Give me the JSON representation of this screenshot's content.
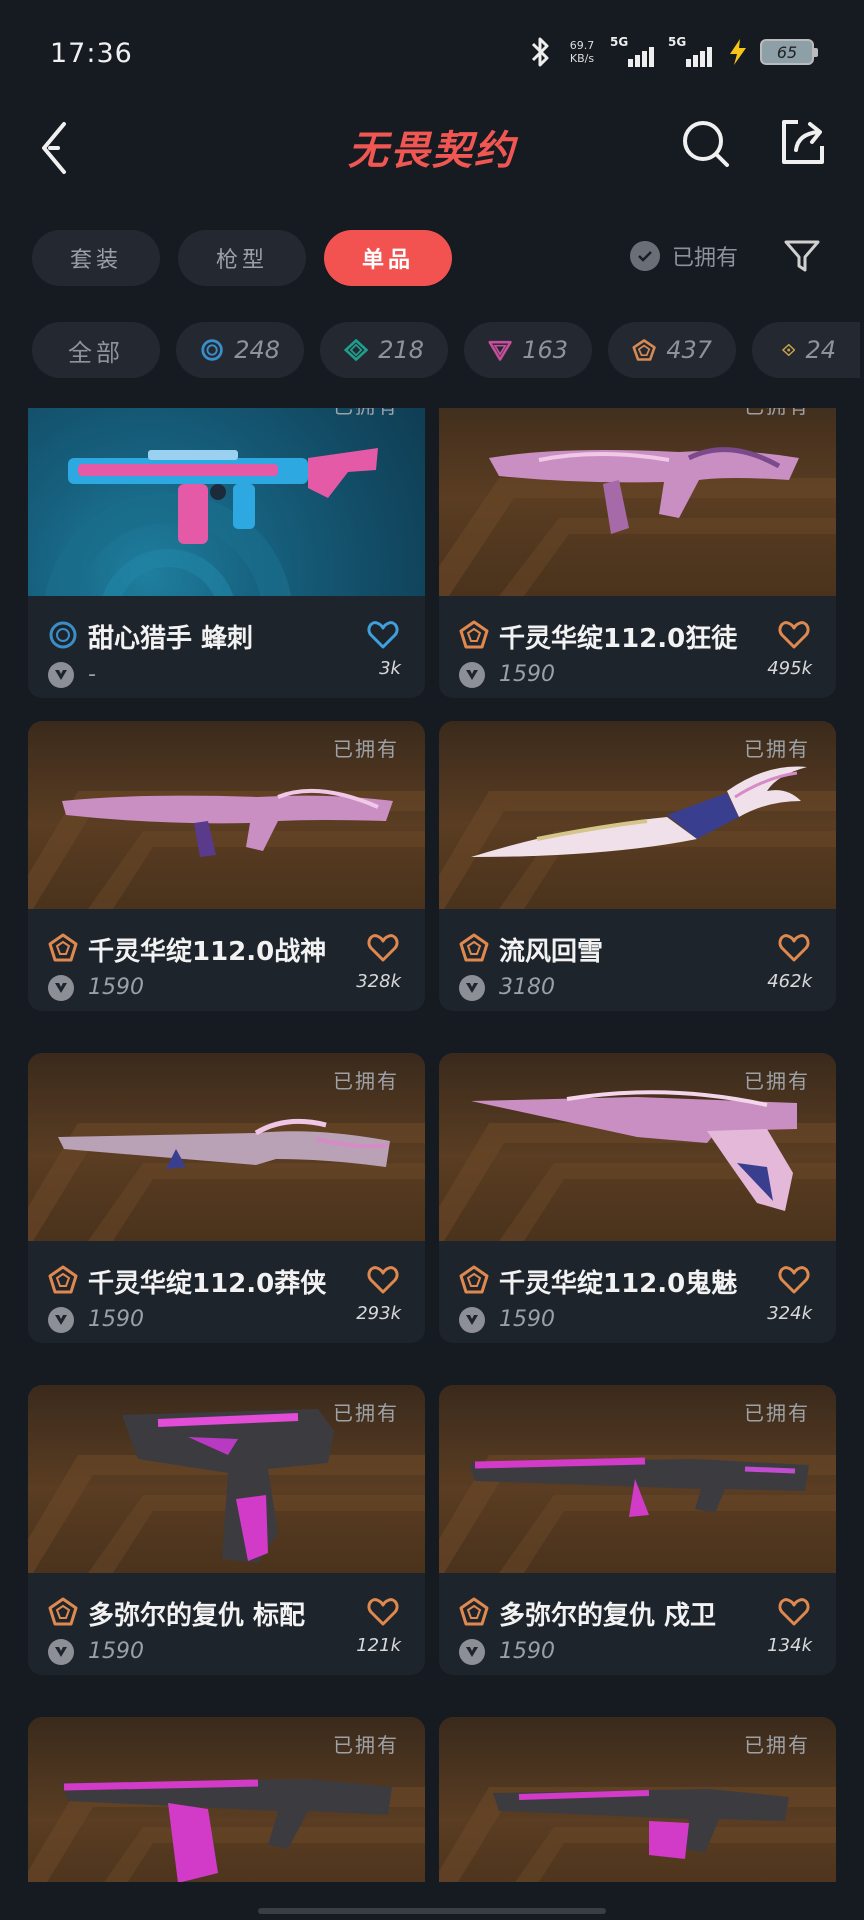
{
  "status_bar": {
    "time": "17:36",
    "net_speed_value": "69.7",
    "net_speed_unit": "KB/s",
    "signal1_label": "5G",
    "signal2_label": "5G",
    "battery": "65"
  },
  "header": {
    "title": "无畏契约",
    "icons": [
      "back-icon",
      "search-icon",
      "share-icon"
    ]
  },
  "tabs": [
    {
      "label": "套装",
      "active": false
    },
    {
      "label": "枪型",
      "active": false
    },
    {
      "label": "单品",
      "active": true
    }
  ],
  "owned_filter_label": "已拥有",
  "rarity_filters": [
    {
      "label": "全部"
    },
    {
      "count": "248",
      "icon": "select-tier-icon",
      "color": "#3a8ec8"
    },
    {
      "count": "218",
      "icon": "deluxe-tier-icon",
      "color": "#1f9f8e"
    },
    {
      "count": "163",
      "icon": "premium-tier-icon",
      "color": "#c64e9a"
    },
    {
      "count": "437",
      "icon": "exclusive-tier-icon",
      "color": "#d88a52"
    },
    {
      "count": "24",
      "icon": "ultra-tier-icon",
      "color": "#c9a24a"
    }
  ],
  "owned_tag": "已拥有",
  "cards": [
    {
      "name": "甜心猎手 蜂刺",
      "price": "-",
      "favorites": "3k",
      "tier_color": "#3a8ec8",
      "fav_color": "#3ea0dc"
    },
    {
      "name": "千灵华绽112.0狂徒",
      "price": "1590",
      "favorites": "495k",
      "tier_color": "#e0894f",
      "fav_color": "#e0894f"
    },
    {
      "name": "千灵华绽112.0战神",
      "price": "1590",
      "favorites": "328k",
      "tier_color": "#e0894f",
      "fav_color": "#e0894f"
    },
    {
      "name": "流风回雪",
      "price": "3180",
      "favorites": "462k",
      "tier_color": "#e0894f",
      "fav_color": "#e0894f"
    },
    {
      "name": "千灵华绽112.0莽侠",
      "price": "1590",
      "favorites": "293k",
      "tier_color": "#e0894f",
      "fav_color": "#e0894f"
    },
    {
      "name": "千灵华绽112.0鬼魅",
      "price": "1590",
      "favorites": "324k",
      "tier_color": "#e0894f",
      "fav_color": "#e0894f"
    },
    {
      "name": "多弥尔的复仇 标配",
      "price": "1590",
      "favorites": "121k",
      "tier_color": "#e0894f",
      "fav_color": "#e0894f"
    },
    {
      "name": "多弥尔的复仇 戍卫",
      "price": "1590",
      "favorites": "134k",
      "tier_color": "#e0894f",
      "fav_color": "#e0894f"
    }
  ]
}
